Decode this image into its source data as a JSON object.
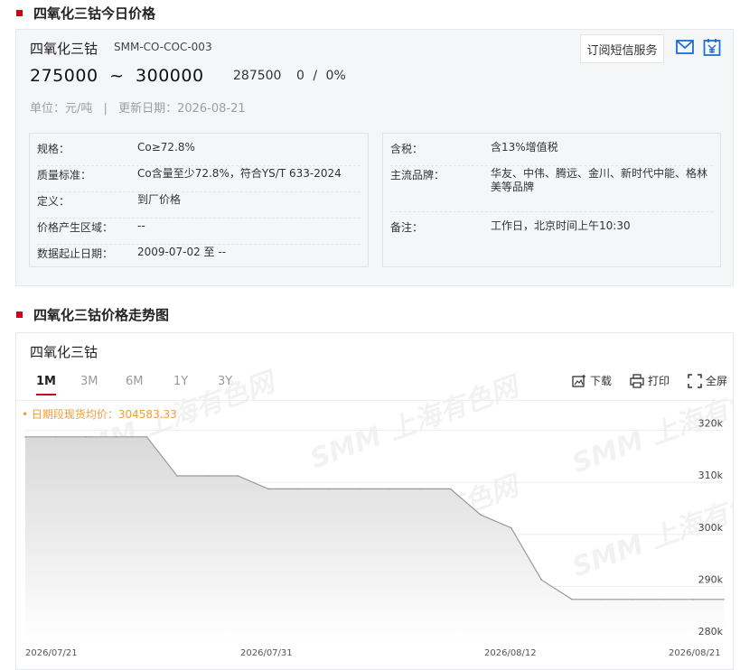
{
  "section1": {
    "title": "四氧化三钴今日价格"
  },
  "product": {
    "name": "四氧化三钴",
    "code": "SMM-CO-COC-003",
    "price_low": "275000",
    "price_sep": "~",
    "price_high": "300000",
    "avg": "287500",
    "change": "0",
    "change_sep": "/",
    "change_pct": "0%",
    "unit_label": "单位：元/吨",
    "meta_sep": "|",
    "update_label": "更新日期：2026-08-21",
    "subscribe_label": "订阅短信服务",
    "mail_icon": "mail-icon",
    "calendar_icon": "calendar-icon"
  },
  "spec_left": [
    {
      "key": "规格：",
      "value": "Co≥72.8%"
    },
    {
      "key": "质量标准：",
      "value": "Co含量至少72.8%，符合YS/T 633-2024"
    },
    {
      "key": "定义：",
      "value": "到厂价格"
    },
    {
      "key": "价格产生区域：",
      "value": "--"
    },
    {
      "key": "数据起止日期：",
      "value": "2009-07-02 至 --"
    }
  ],
  "spec_right": [
    {
      "key": "含税：",
      "value": "含13%增值税"
    },
    {
      "key": "主流品牌：",
      "value": "华友、中伟、腾远、金川、新时代中能、格林美等品牌"
    },
    {
      "key": "备注：",
      "value": "工作日，北京时间上午10:30"
    }
  ],
  "section2": {
    "title": "四氧化三钴价格走势图"
  },
  "chart_panel": {
    "name": "四氧化三钴",
    "ranges": [
      "1M",
      "3M",
      "6M",
      "1Y",
      "3Y"
    ],
    "active_range": "1M",
    "download_label": "下载",
    "print_label": "打印",
    "fullscreen_label": "全屏",
    "avg_note": "• 日期段现货均价：304583.33",
    "watermark": "SMM 上海有色网"
  },
  "chart_data": {
    "type": "area",
    "x": [
      "2026/07/21",
      "2026/07/22",
      "2026/07/23",
      "2026/07/24",
      "2026/07/27",
      "2026/07/28",
      "2026/07/29",
      "2026/07/30",
      "2026/07/31",
      "2026/08/03",
      "2026/08/04",
      "2026/08/05",
      "2026/08/06",
      "2026/08/07",
      "2026/08/10",
      "2026/08/11",
      "2026/08/12",
      "2026/08/13",
      "2026/08/14",
      "2026/08/17",
      "2026/08/18",
      "2026/08/19",
      "2026/08/20",
      "2026/08/21"
    ],
    "series": [
      {
        "values": [
          318750,
          318750,
          318750,
          318750,
          318750,
          311250,
          311250,
          311250,
          308750,
          308750,
          308750,
          308750,
          308750,
          308750,
          308750,
          303750,
          301250,
          291250,
          287500,
          287500,
          287500,
          287500,
          287500,
          287500
        ]
      }
    ],
    "x_tick_labels": [
      "2026/07/21",
      "2026/07/31",
      "2026/08/12",
      "2026/08/21"
    ],
    "y_ticks": [
      "320k",
      "310k",
      "300k",
      "290k",
      "280k"
    ],
    "ylim": [
      280000,
      320000
    ],
    "grid": "horizontal",
    "colors": {
      "line": "#999999",
      "fill_top": "#d9d9d9",
      "fill_bottom": "#ffffff"
    }
  },
  "colors": {
    "accent": "#d0021b",
    "note": "#f39c3d",
    "icon_blue": "#1d6fd4"
  }
}
